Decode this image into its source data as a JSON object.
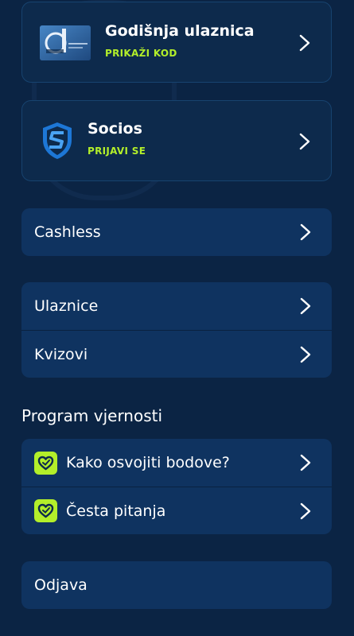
{
  "cards": [
    {
      "title": "Godišnja ulaznica",
      "action": "PRIKAŽI KOD",
      "icon": "season-ticket-icon"
    },
    {
      "title": "Socios",
      "action": "PRIJAVI SE",
      "icon": "socios-logo-icon"
    }
  ],
  "menu": {
    "cashless": "Cashless",
    "ulaznice": "Ulaznice",
    "kvizovi": "Kvizovi"
  },
  "loyalty": {
    "heading": "Program vjernosti",
    "items": [
      {
        "label": "Kako osvojiti bodove?",
        "icon": "loyalty-heart-icon"
      },
      {
        "label": "Česta pitanja",
        "icon": "loyalty-heart-icon"
      }
    ]
  },
  "logout": "Odjava",
  "colors": {
    "background": "#0b2444",
    "panel": "#0f3360",
    "accent": "#b3ef2a"
  }
}
